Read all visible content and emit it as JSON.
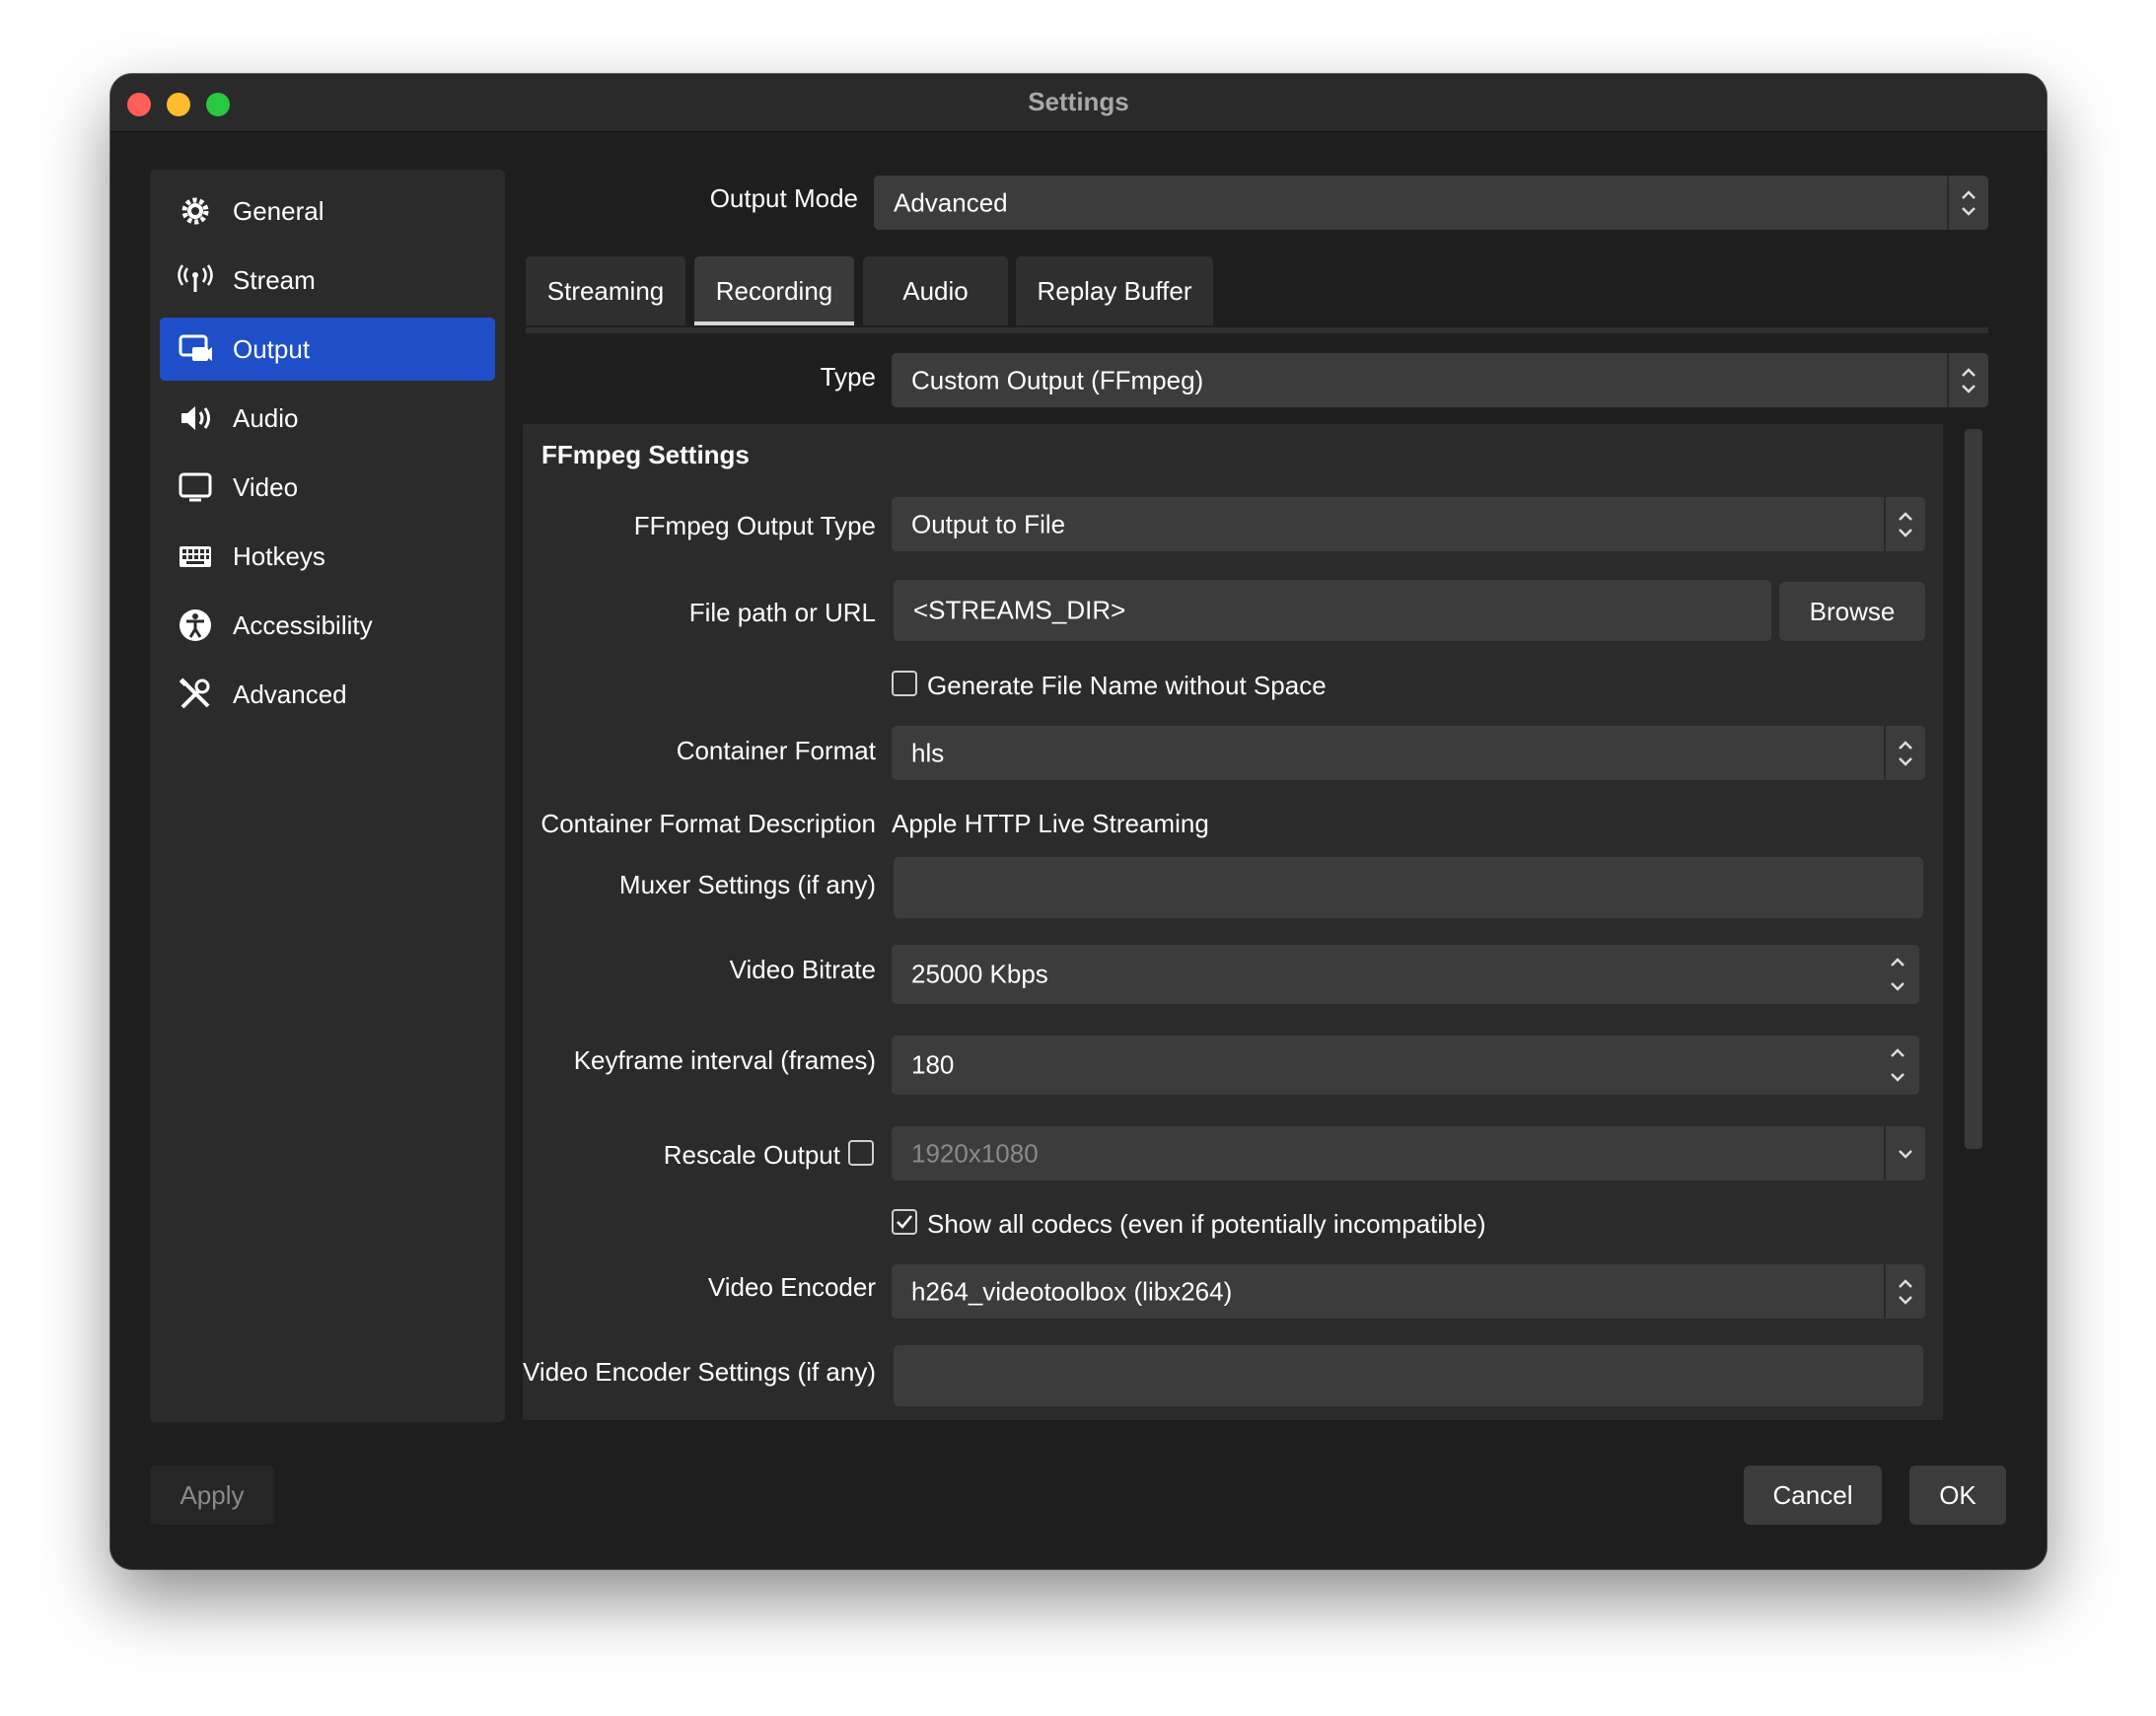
{
  "window": {
    "title": "Settings"
  },
  "sidebar": {
    "items": [
      {
        "label": "General",
        "icon": "gear-icon"
      },
      {
        "label": "Stream",
        "icon": "antenna-icon"
      },
      {
        "label": "Output",
        "icon": "output-icon",
        "active": true
      },
      {
        "label": "Audio",
        "icon": "speaker-icon"
      },
      {
        "label": "Video",
        "icon": "monitor-icon"
      },
      {
        "label": "Hotkeys",
        "icon": "keyboard-icon"
      },
      {
        "label": "Accessibility",
        "icon": "accessibility-icon"
      },
      {
        "label": "Advanced",
        "icon": "tools-icon"
      }
    ]
  },
  "output_mode": {
    "label": "Output Mode",
    "value": "Advanced"
  },
  "tabs": [
    {
      "label": "Streaming"
    },
    {
      "label": "Recording",
      "active": true
    },
    {
      "label": "Audio"
    },
    {
      "label": "Replay Buffer"
    }
  ],
  "type": {
    "label": "Type",
    "value": "Custom Output (FFmpeg)"
  },
  "ffmpeg": {
    "title": "FFmpeg Settings",
    "output_type": {
      "label": "FFmpeg Output Type",
      "value": "Output to File"
    },
    "file_path": {
      "label": "File path or URL",
      "value": "<STREAMS_DIR>",
      "browse": "Browse"
    },
    "gen_name": {
      "label": "Generate File Name without Space",
      "checked": false
    },
    "container_format": {
      "label": "Container Format",
      "value": "hls"
    },
    "container_desc": {
      "label": "Container Format Description",
      "value": "Apple HTTP Live Streaming"
    },
    "muxer_settings": {
      "label": "Muxer Settings (if any)",
      "value": ""
    },
    "video_bitrate": {
      "label": "Video Bitrate",
      "value": "25000 Kbps"
    },
    "keyframe": {
      "label": "Keyframe interval (frames)",
      "value": "180"
    },
    "rescale": {
      "label": "Rescale Output",
      "checked": false,
      "value": "1920x1080"
    },
    "show_codecs": {
      "label": "Show all codecs (even if potentially incompatible)",
      "checked": true
    },
    "video_encoder": {
      "label": "Video Encoder",
      "value": "h264_videotoolbox (libx264)"
    },
    "encoder_settings": {
      "label": "Video Encoder Settings (if any)",
      "value": ""
    }
  },
  "footer": {
    "apply": "Apply",
    "cancel": "Cancel",
    "ok": "OK"
  },
  "colors": {
    "accent": "#1f4fc8",
    "window_bg": "#1e1e1e",
    "field_bg": "#3c3c3c"
  }
}
